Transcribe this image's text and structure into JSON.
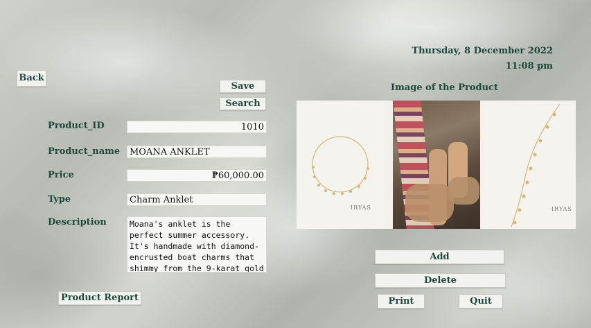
{
  "header": {
    "date": "Thursday, 8 December 2022",
    "time": "11:08 pm",
    "back_label": "Back"
  },
  "toolbar": {
    "save_label": "Save",
    "search_label": "Search"
  },
  "form": {
    "product_id_label": "Product_ID",
    "product_id_value": "1010",
    "product_name_label": "Product_name",
    "product_name_value": "MOANA ANKLET",
    "price_label": "Price",
    "price_value": "₱60,000.00",
    "type_label": "Type",
    "type_value": "Charm Anklet",
    "description_label": "Description",
    "description_value": "Moana's anklet is the perfect summer accessory. It's handmade with diamond-encrusted boat charms that shimmy from the 9-karat gold"
  },
  "product_image": {
    "caption": "Image of the Product",
    "brand_left": "IRYAS",
    "brand_right": "IRYAS"
  },
  "actions": {
    "add_label": "Add",
    "delete_label": "Delete",
    "print_label": "Print",
    "quit_label": "Quit",
    "report_label": "Product Report"
  },
  "colors": {
    "label_text": "#1b4a3c",
    "field_bg": "#f7f7f5",
    "button_bg": "#f2f2ef"
  }
}
